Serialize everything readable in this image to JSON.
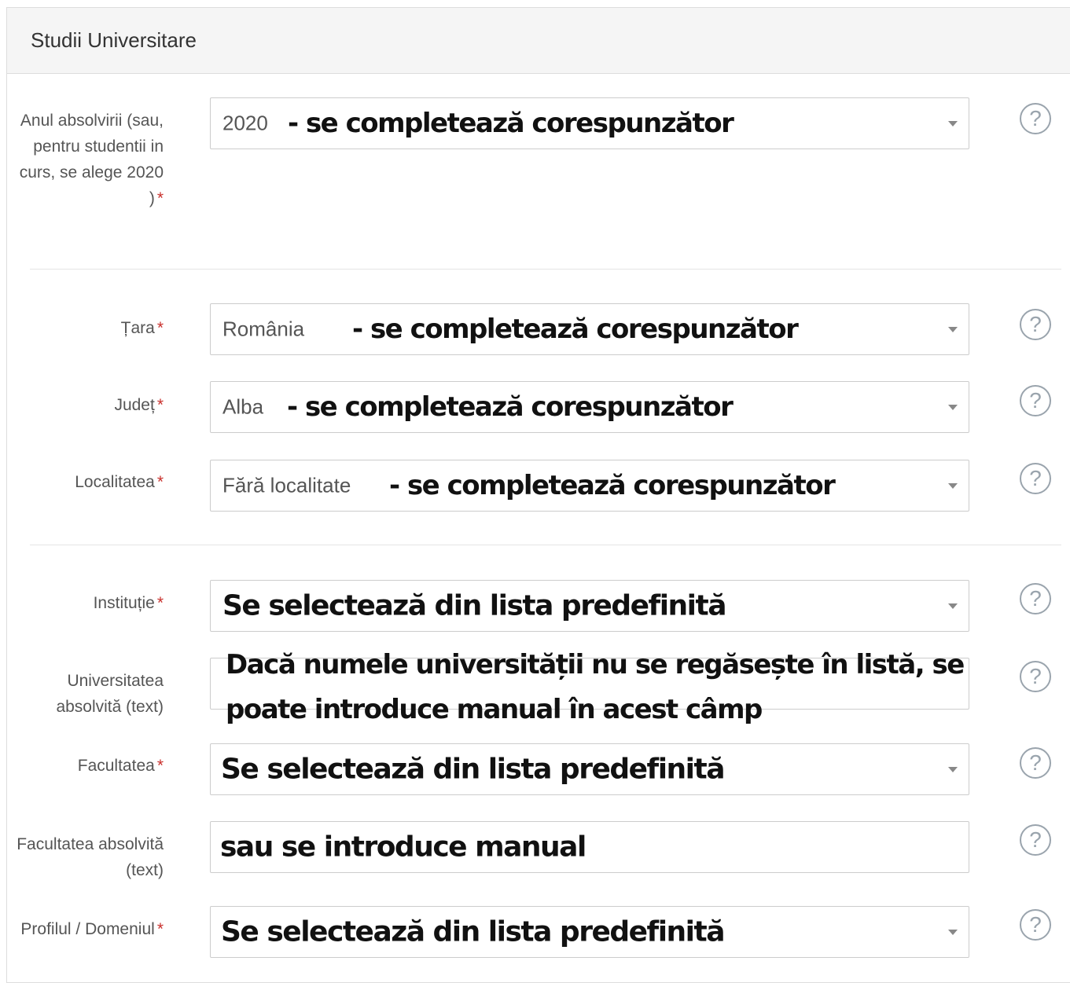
{
  "panel": {
    "title": "Studii Universitare"
  },
  "required_mark": "*",
  "help_glyph": "?",
  "fields": {
    "anul": {
      "label": "Anul absolvirii (sau, pentru studentii in curs, se alege 2020 )",
      "value": "2020",
      "note": "- se completează corespunzător"
    },
    "tara": {
      "label": "Țara",
      "value": "România",
      "note": "- se completează corespunzător"
    },
    "judet": {
      "label": "Județ",
      "value": "Alba",
      "note": "- se completează corespunzător"
    },
    "localitatea": {
      "label": "Localitatea",
      "value": "Fără localitate",
      "note": "- se completează corespunzător"
    },
    "institutie": {
      "label": "Instituție",
      "note": "Se selectează din lista predefinită"
    },
    "universitatea_text": {
      "label": "Universitatea absolvită (text)",
      "note_line1": "Dacă numele universității nu se regăsește în listă, se",
      "note_line2": "poate introduce manual în acest câmp"
    },
    "facultatea": {
      "label": "Facultatea",
      "note": "Se selectează din lista predefinită"
    },
    "facultatea_text": {
      "label": "Facultatea absolvită (text)",
      "note": "sau se introduce manual"
    },
    "profilul": {
      "label": "Profilul / Domeniul",
      "note": "Se selectează din lista predefinită"
    }
  },
  "colors": {
    "required": "#c9302c",
    "heading_bg": "#f5f5f5",
    "help_icon": "#9aa4ad"
  }
}
